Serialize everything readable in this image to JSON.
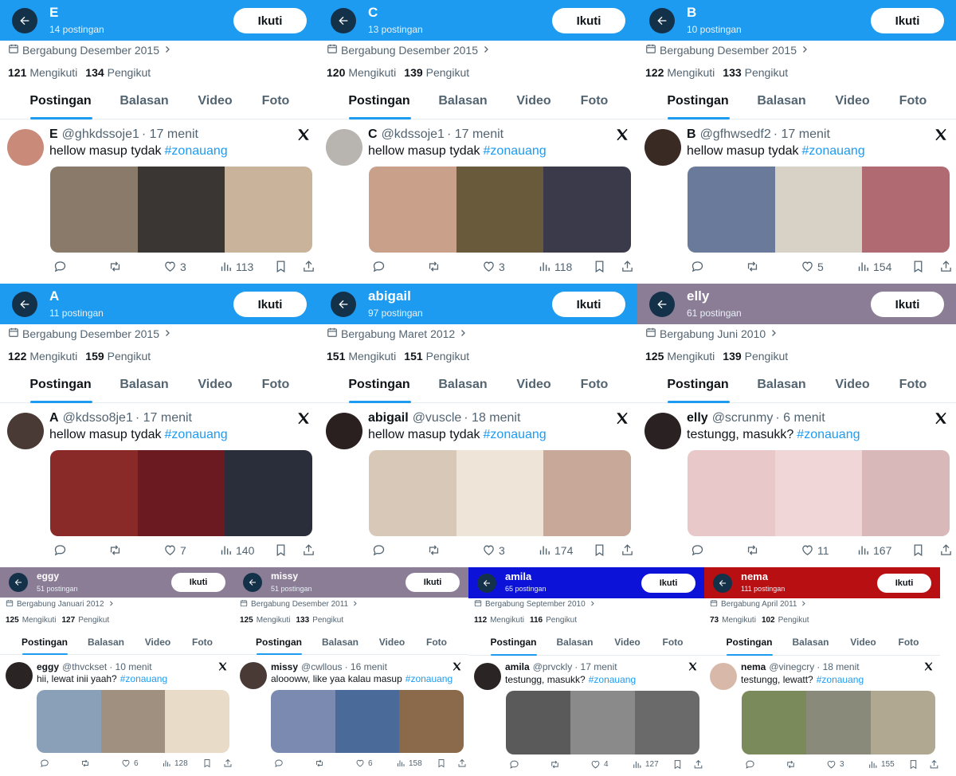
{
  "follow_label": "Ikuti",
  "tabs": [
    "Postingan",
    "Balasan",
    "Video",
    "Foto"
  ],
  "following_label": "Mengikuti",
  "followers_label": "Pengikut",
  "panels": [
    {
      "name": "E",
      "posts": "14 postingan",
      "joined": "Bergabung Desember 2015",
      "following": "121",
      "followers": "134",
      "handle": "@ghkdssoje1",
      "time": "· 17 menit",
      "text": "hellow masup tydak",
      "hashtag": "#zonauang",
      "likes": "3",
      "views": "113",
      "header_color": "#1d9bf0",
      "avatar_color": "#c98a7a",
      "media": [
        "#8a7a6a",
        "#3a3634",
        "#c9b39a"
      ]
    },
    {
      "name": "C",
      "posts": "13 postingan",
      "joined": "Bergabung Desember 2015",
      "following": "120",
      "followers": "139",
      "handle": "@kdssoje1",
      "time": "· 17 menit",
      "text": "hellow masup tydak",
      "hashtag": "#zonauang",
      "likes": "3",
      "views": "118",
      "header_color": "#1d9bf0",
      "avatar_color": "#b8b4b0",
      "media": [
        "#c9a08a",
        "#6a5a3c",
        "#3a3a4a"
      ]
    },
    {
      "name": "B",
      "posts": "10 postingan",
      "joined": "Bergabung Desember 2015",
      "following": "122",
      "followers": "133",
      "handle": "@gfhwsedf2",
      "time": "· 17 menit",
      "text": "hellow masup tydak",
      "hashtag": "#zonauang",
      "likes": "5",
      "views": "154",
      "header_color": "#1d9bf0",
      "avatar_color": "#3a2a24",
      "media": [
        "#6a7a9a",
        "#d8d2c6",
        "#b06a72"
      ]
    },
    {
      "name": "A",
      "posts": "11 postingan",
      "joined": "Bergabung Desember 2015",
      "following": "122",
      "followers": "159",
      "handle": "@kdsso8je1",
      "time": "· 17 menit",
      "text": "hellow masup tydak",
      "hashtag": "#zonauang",
      "likes": "7",
      "views": "140",
      "header_color": "#1d9bf0",
      "avatar_color": "#4a3a36",
      "media": [
        "#8a2a28",
        "#6a1a20",
        "#2a2e3a"
      ]
    },
    {
      "name": "abigail",
      "posts": "97 postingan",
      "joined": "Bergabung Maret 2012",
      "following": "151",
      "followers": "151",
      "handle": "@vuscle",
      "time": "· 18 menit",
      "text": "hellow masup tydak",
      "hashtag": "#zonauang",
      "likes": "3",
      "views": "174",
      "header_color": "#1d9bf0",
      "avatar_color": "#2a2020",
      "media": [
        "#d8c8b8",
        "#eee4d8",
        "#c8a898"
      ]
    },
    {
      "name": "elly",
      "posts": "61 postingan",
      "joined": "Bergabung Juni 2010",
      "following": "125",
      "followers": "139",
      "handle": "@scrunmy",
      "time": "· 6 menit",
      "text": "testungg, masukk?",
      "hashtag": "#zonauang",
      "likes": "11",
      "views": "167",
      "header_color": "#8c7d96",
      "avatar_color": "#2a2222",
      "media": [
        "#e8c8c8",
        "#f0d6d6",
        "#d8b8b8"
      ]
    },
    {
      "name": "eggy",
      "posts": "51 postingan",
      "joined": "Bergabung Januari 2012",
      "following": "125",
      "followers": "127",
      "handle": "@thvckset",
      "time": "· 10 menit",
      "text": "hii, lewat inii yaah?",
      "hashtag": "#zonauang",
      "likes": "6",
      "views": "128",
      "header_color": "#8c7d96",
      "avatar_color": "#2a2424",
      "media": [
        "#8aa0b8",
        "#a09080",
        "#e8dcc8"
      ]
    },
    {
      "name": "missy",
      "posts": "51 postingan",
      "joined": "Bergabung Desember 2011",
      "following": "125",
      "followers": "133",
      "handle": "@cwllous",
      "time": "· 16 menit",
      "text": "aloooww, like yaa kalau masup",
      "hashtag": "#zonauang",
      "likes": "6",
      "views": "158",
      "header_color": "#8c7d96",
      "avatar_color": "#4a3a36",
      "media": [
        "#7a8ab0",
        "#4a6a9a",
        "#8a6a4a"
      ]
    },
    {
      "name": "amila",
      "posts": "65 postingan",
      "joined": "Bergabung September 2010",
      "following": "112",
      "followers": "116",
      "handle": "@prvckly",
      "time": "· 17 menit",
      "text": "testungg, masukk?",
      "hashtag": "#zonauang",
      "likes": "4",
      "views": "127",
      "header_color": "#0d12d8",
      "avatar_color": "#2a2424",
      "media": [
        "#5a5a5a",
        "#8a8a8a",
        "#6a6a6a"
      ]
    },
    {
      "name": "nema",
      "posts": "111 postingan",
      "joined": "Bergabung April 2011",
      "following": "73",
      "followers": "102",
      "handle": "@vinegcry",
      "time": "· 18 menit",
      "text": "testungg, lewatt?",
      "hashtag": "#zonauang",
      "likes": "3",
      "views": "155",
      "header_color": "#b80f12",
      "avatar_color": "#d8b8a8",
      "media": [
        "#7a8a5a",
        "#8a8a7a",
        "#b0a890"
      ]
    }
  ]
}
